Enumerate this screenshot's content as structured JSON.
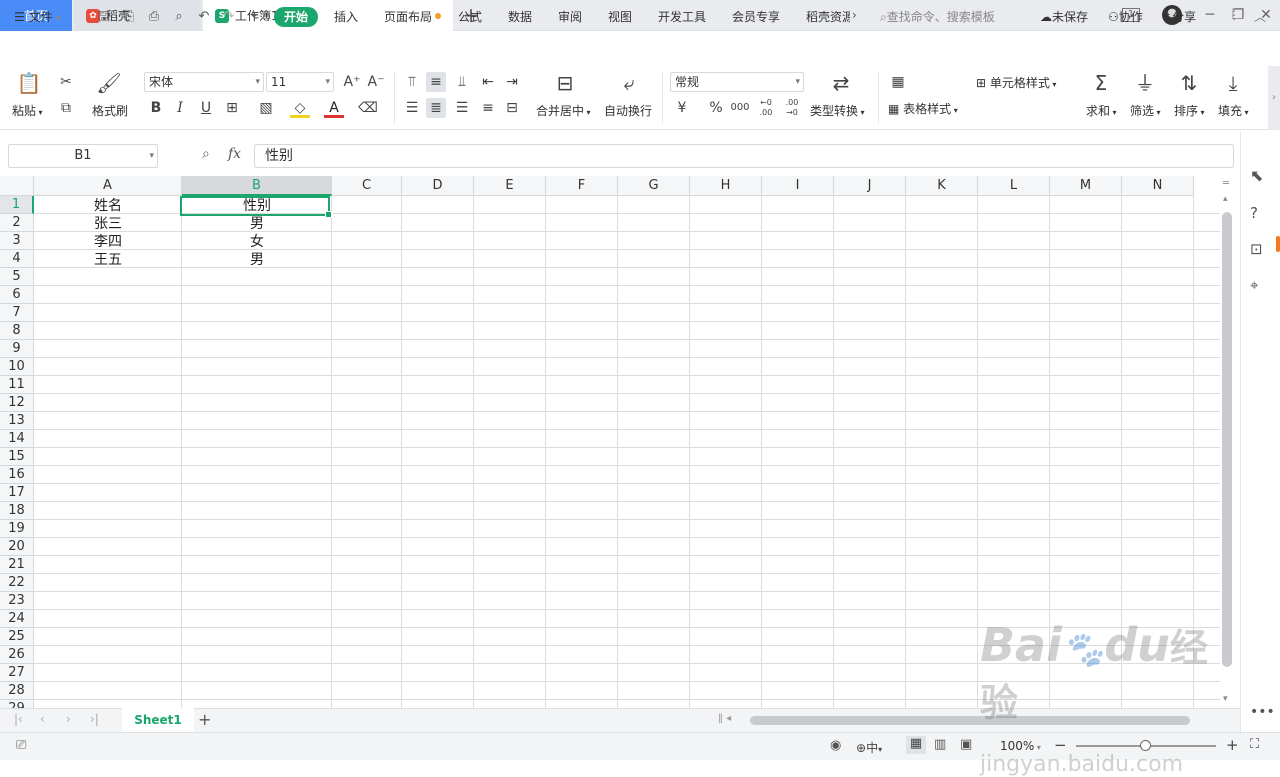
{
  "tabs": {
    "home": "首页",
    "daoke": "稻壳",
    "workbook": "工作簿1"
  },
  "title_indicator": "1",
  "menu": {
    "file": "文件",
    "start": "开始",
    "items": [
      "插入",
      "页面布局",
      "公式",
      "数据",
      "审阅",
      "视图",
      "开发工具",
      "会员专享",
      "稻壳资源"
    ],
    "search_placeholder": "查找命令、搜索模板",
    "unsaved": "未保存",
    "collab": "协作",
    "share": "分享"
  },
  "ribbon": {
    "paste": "粘贴",
    "format_painter": "格式刷",
    "font": "宋体",
    "size": "11",
    "merge": "合并居中",
    "wrap": "自动换行",
    "num_format": "常规",
    "convert": "类型转换",
    "cell_style": "单元格样式",
    "table_style": "表格样式",
    "sum": "求和",
    "filter": "筛选",
    "sort": "排序",
    "fill": "填充",
    "currency": "¥",
    "percent": "%",
    "thousands": "000",
    "inc_dec": "←0 .00",
    "dec_dec": ".00 →0"
  },
  "formula": {
    "cell_ref": "B1",
    "fx": "fx",
    "value": "性别"
  },
  "columns": [
    "A",
    "B",
    "C",
    "D",
    "E",
    "F",
    "G",
    "H",
    "I",
    "J",
    "K",
    "L",
    "M",
    "N"
  ],
  "rows": [
    "1",
    "2",
    "3",
    "4",
    "5",
    "6",
    "7",
    "8",
    "9",
    "10",
    "11",
    "12",
    "13",
    "14",
    "15",
    "16",
    "17",
    "18",
    "19",
    "20",
    "21",
    "22",
    "23",
    "24",
    "25",
    "26",
    "27",
    "28",
    "29"
  ],
  "cells": {
    "A1": "姓名",
    "B1": "性别",
    "A2": "张三",
    "B2": "男",
    "A3": "李四",
    "B3": "女",
    "A4": "王五",
    "B4": "男"
  },
  "sheet": {
    "name": "Sheet1"
  },
  "status": {
    "zoom": "100%",
    "input_mode": "中"
  },
  "watermark": {
    "brand": "Bai",
    "brand2": "du",
    "brand3": "经验",
    "url": "jingyan.baidu.com"
  },
  "colors": {
    "accent": "#1aa66c",
    "home_tab": "#4a8cf7"
  }
}
